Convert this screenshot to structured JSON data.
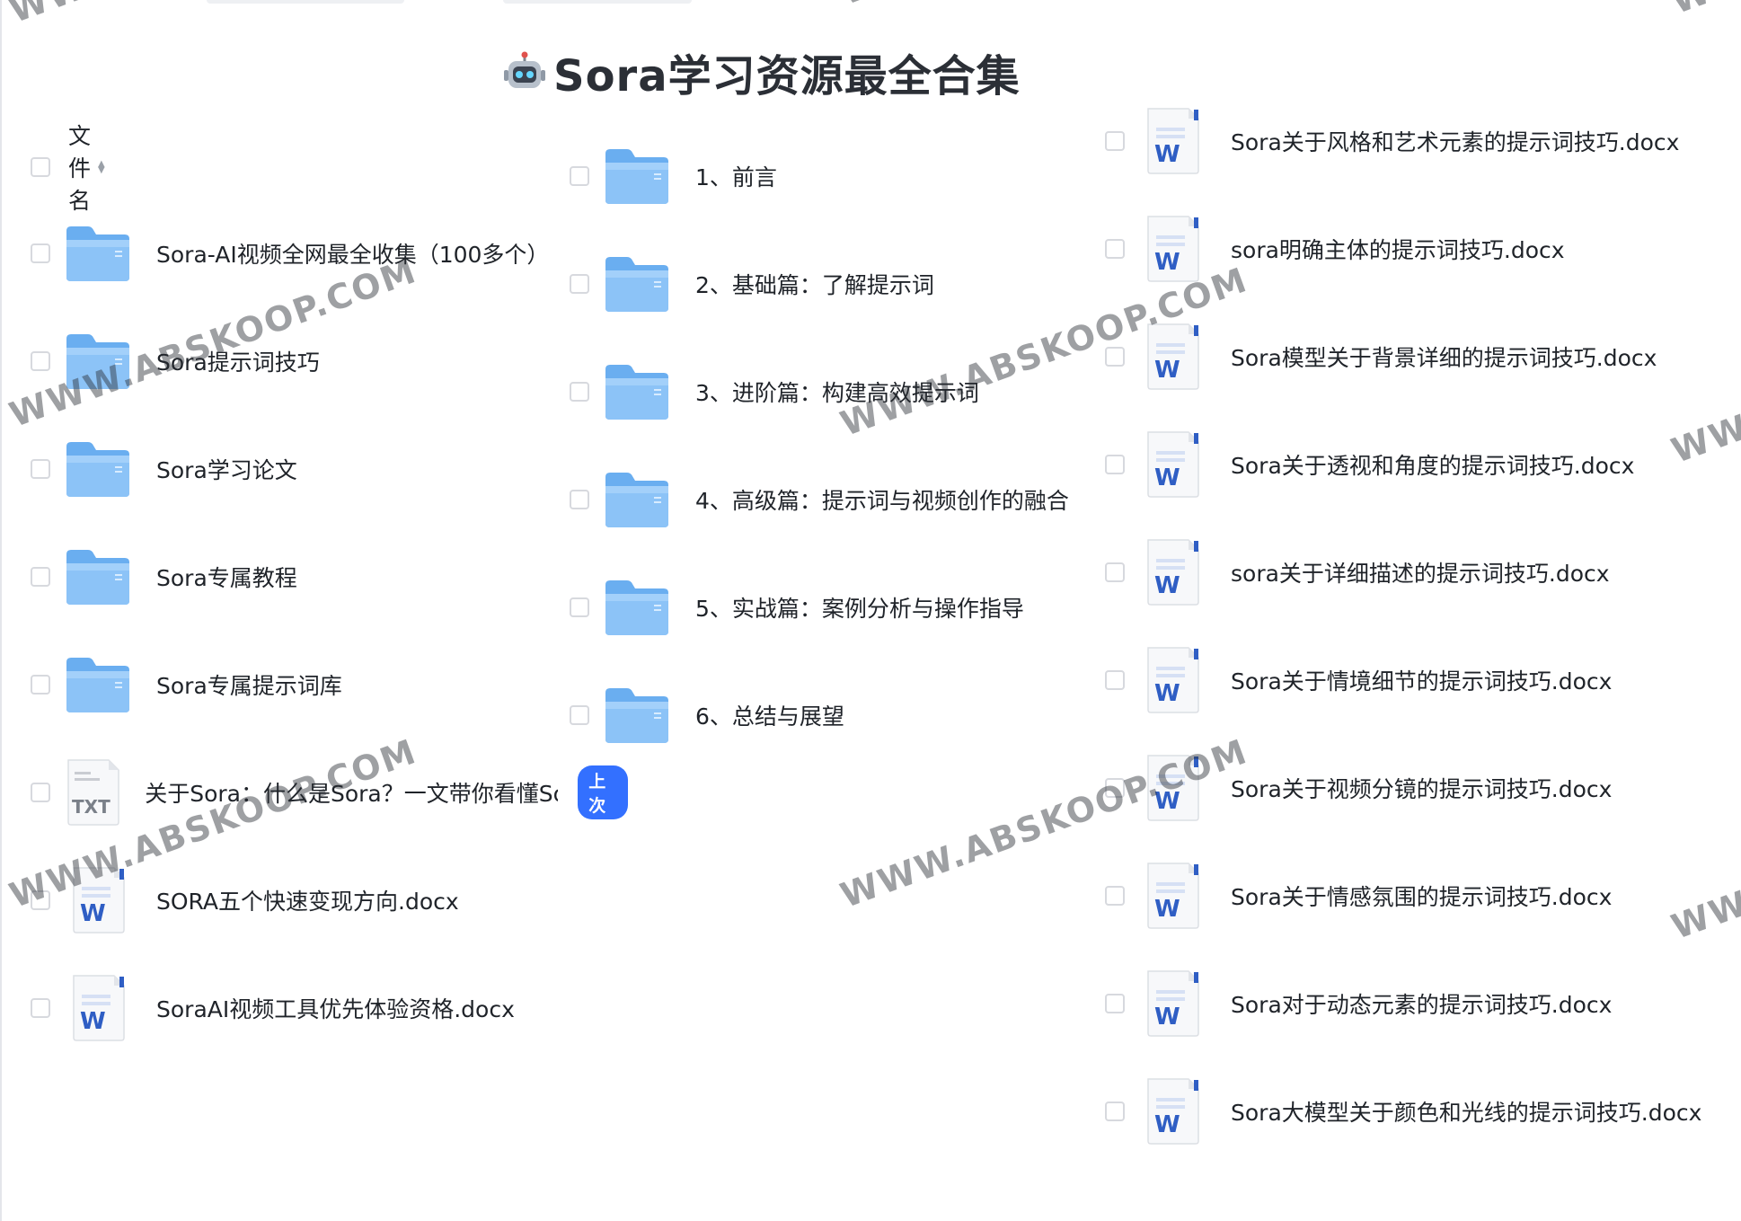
{
  "title": "Sora学习资源最全合集",
  "header": {
    "name_label": "文件名"
  },
  "column_left": [
    {
      "type": "folder",
      "name": "Sora-AI视频全网最全收集（100多个）"
    },
    {
      "type": "folder",
      "name": "Sora提示词技巧"
    },
    {
      "type": "folder",
      "name": "Sora学习论文"
    },
    {
      "type": "folder",
      "name": "Sora专属教程"
    },
    {
      "type": "folder",
      "name": "Sora专属提示词库"
    },
    {
      "type": "txt",
      "name": "关于Sora：什么是Sora？一文带你看懂Sora！.txt",
      "badge": "上次"
    },
    {
      "type": "docx",
      "name": "SORA五个快速变现方向.docx"
    },
    {
      "type": "docx",
      "name": "SoraAI视频工具优先体验资格.docx"
    }
  ],
  "column_middle": [
    {
      "type": "folder",
      "name": "1、前言"
    },
    {
      "type": "folder",
      "name": "2、基础篇：了解提示词"
    },
    {
      "type": "folder",
      "name": "3、进阶篇：构建高效提示词"
    },
    {
      "type": "folder",
      "name": "4、高级篇：提示词与视频创作的融合"
    },
    {
      "type": "folder",
      "name": "5、实战篇：案例分析与操作指导"
    },
    {
      "type": "folder",
      "name": "6、总结与展望"
    }
  ],
  "column_right": [
    {
      "type": "docx",
      "name": "Sora关于风格和艺术元素的提示词技巧.docx"
    },
    {
      "type": "docx",
      "name": "sora明确主体的提示词技巧.docx"
    },
    {
      "type": "docx",
      "name": "Sora模型关于背景详细的提示词技巧.docx"
    },
    {
      "type": "docx",
      "name": "Sora关于透视和角度的提示词技巧.docx"
    },
    {
      "type": "docx",
      "name": "sora关于详细描述的提示词技巧.docx"
    },
    {
      "type": "docx",
      "name": "Sora关于情境细节的提示词技巧.docx"
    },
    {
      "type": "docx",
      "name": "Sora关于视频分镜的提示词技巧.docx"
    },
    {
      "type": "docx",
      "name": "Sora关于情感氛围的提示词技巧.docx"
    },
    {
      "type": "docx",
      "name": "Sora对于动态元素的提示词技巧.docx"
    },
    {
      "type": "docx",
      "name": "Sora大模型关于颜色和光线的提示词技巧.docx"
    }
  ],
  "icons": {
    "txt_label": "TXT",
    "docx_label": "W"
  },
  "watermark": "WWW.ABSKOOP.COM",
  "colors": {
    "folder": "#6aaef0",
    "word_blue": "#2f5ec4",
    "badge": "#3370ff"
  }
}
